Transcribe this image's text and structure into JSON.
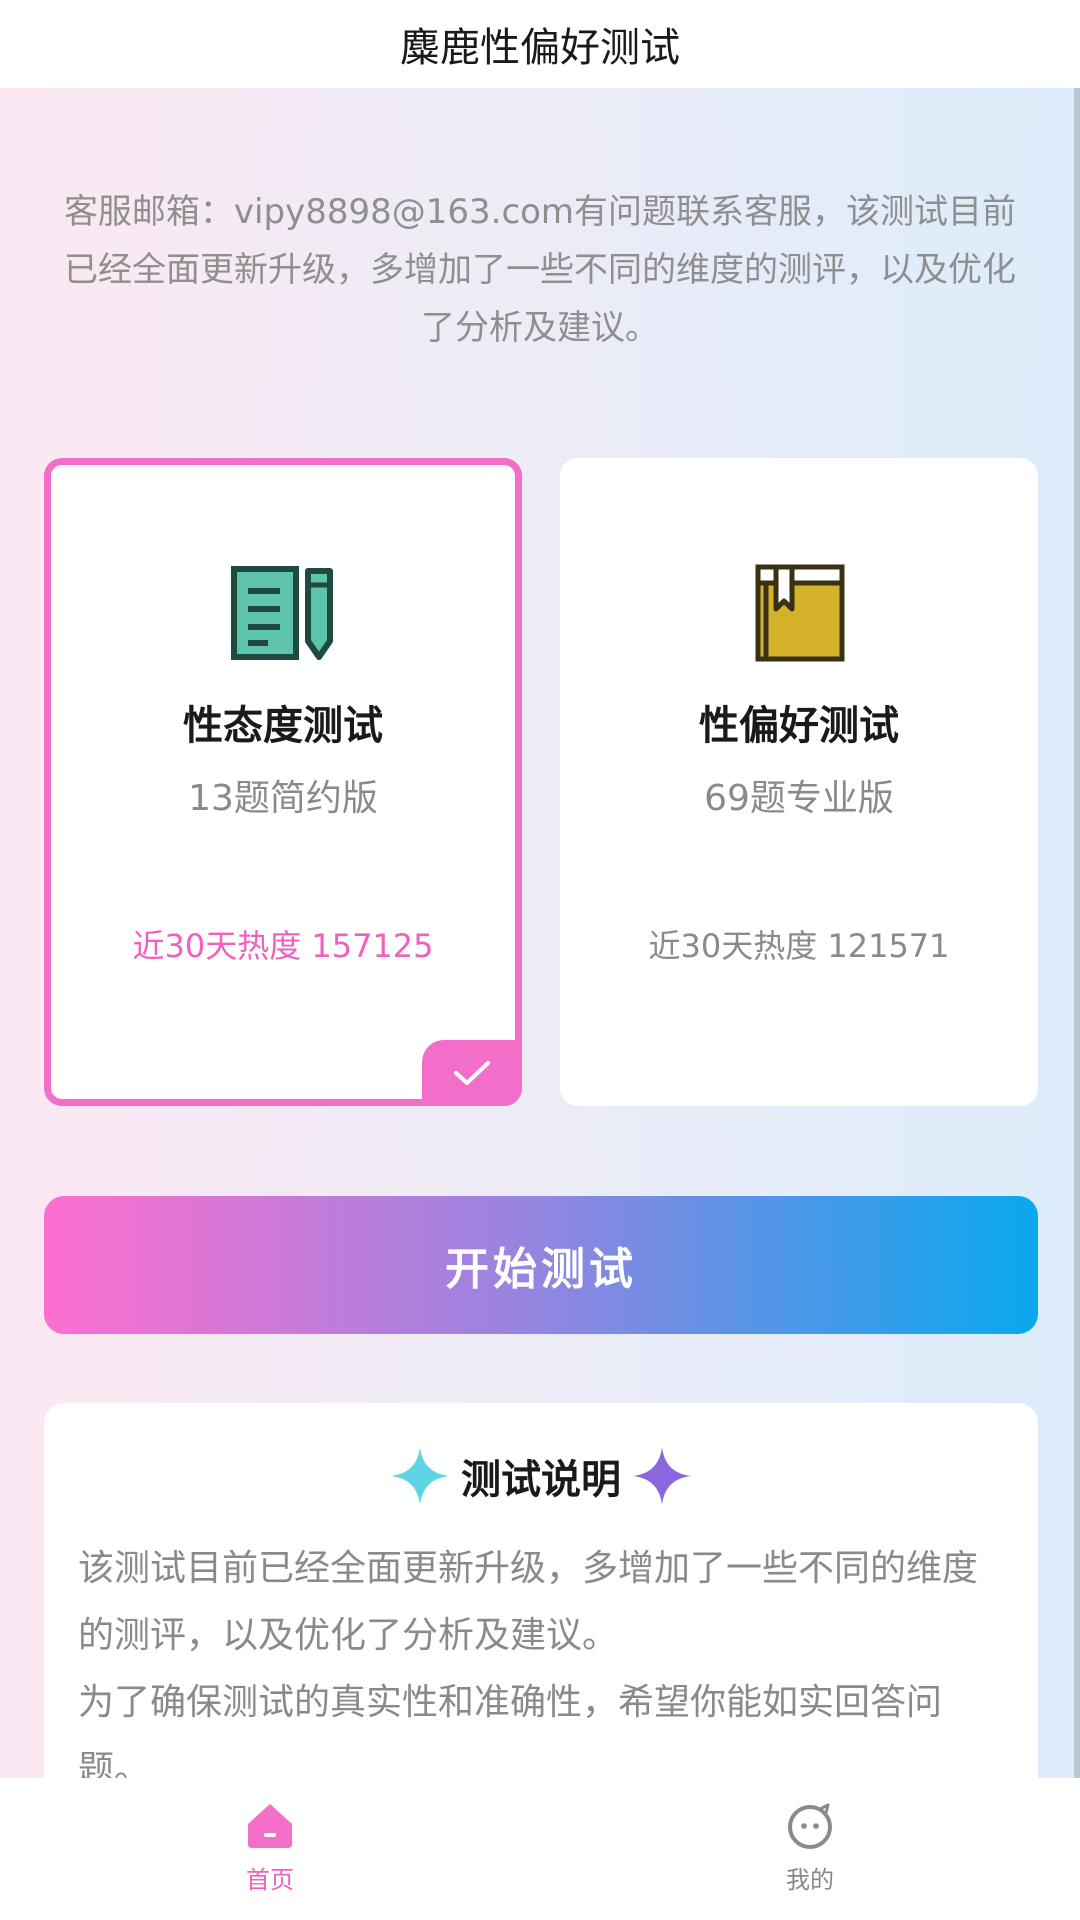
{
  "header": {
    "title": "麋鹿性偏好测试"
  },
  "notice": "客服邮箱：vipy8898@163.com有问题联系客服，该测试目前已经全面更新升级，多增加了一些不同的维度的测评，以及优化了分析及建议。",
  "cards": [
    {
      "title": "性态度测试",
      "subtitle": "13题简约版",
      "heat": "近30天热度 157125",
      "selected": true,
      "icon": "notes-pencil-icon"
    },
    {
      "title": "性偏好测试",
      "subtitle": "69题专业版",
      "heat": "近30天热度 121571",
      "selected": false,
      "icon": "bookmark-book-icon"
    }
  ],
  "start_button": {
    "label": "开始测试"
  },
  "description": {
    "title": "测试说明",
    "paragraphs": [
      "该测试目前已经全面更新升级，多增加了一些不同的维度的测评，以及优化了分析及建议。",
      "为了确保测试的真实性和准确性，希望你能如实回答问题。"
    ]
  },
  "tabbar": {
    "items": [
      {
        "label": "首页",
        "icon": "home-icon",
        "active": true
      },
      {
        "label": "我的",
        "icon": "smiley-icon",
        "active": false
      }
    ]
  },
  "colors": {
    "accent_pink": "#f26ec8",
    "accent_blue": "#0aa8ef",
    "text_gray": "#8a8a8a"
  }
}
